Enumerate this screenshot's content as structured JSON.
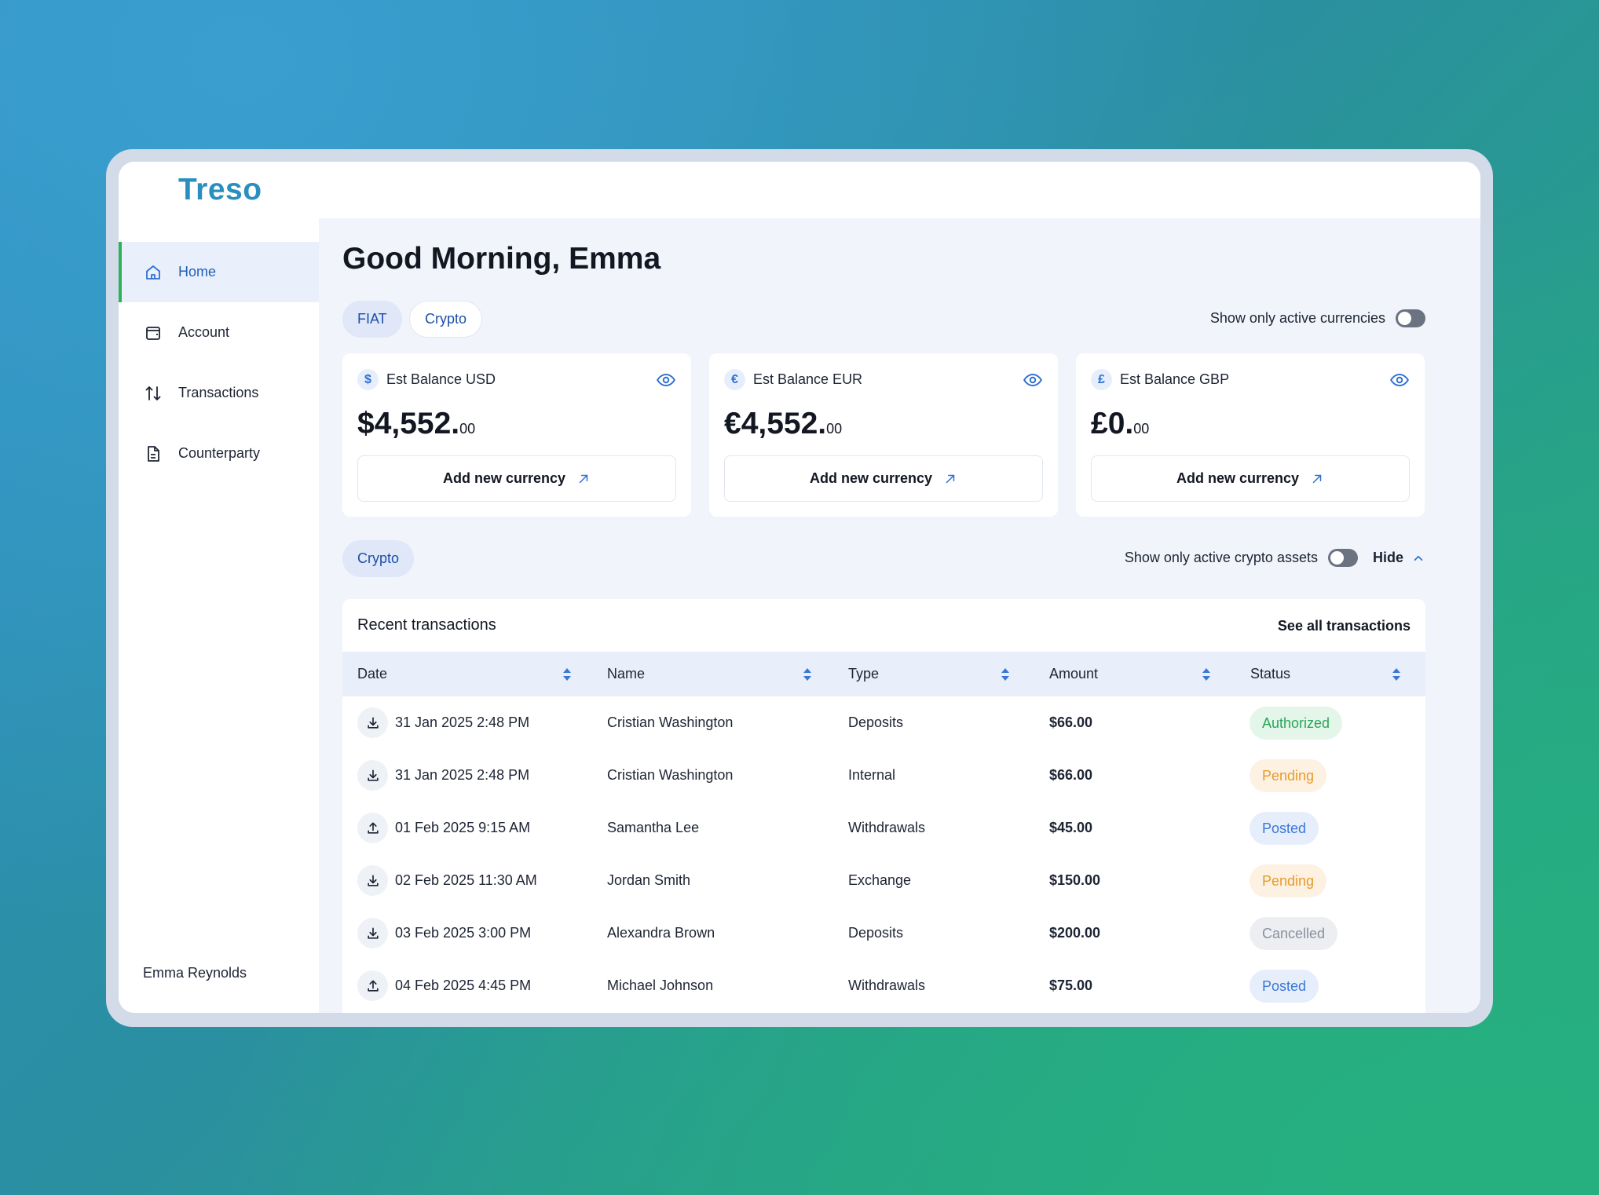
{
  "app": {
    "logo": "Treso"
  },
  "sidebar": {
    "items": [
      {
        "label": "Home",
        "icon": "home-icon",
        "active": true
      },
      {
        "label": "Account",
        "icon": "wallet-icon",
        "active": false
      },
      {
        "label": "Transactions",
        "icon": "arrows-up-down-icon",
        "active": false
      },
      {
        "label": "Counterparty",
        "icon": "document-icon",
        "active": false
      }
    ],
    "user_name": "Emma Reynolds"
  },
  "greeting": "Good Morning, Emma",
  "currency_tabs": {
    "fiat": "FIAT",
    "crypto": "Crypto"
  },
  "active_currencies_toggle": {
    "label": "Show only active currencies",
    "on": false
  },
  "balances": [
    {
      "symbol": "$",
      "label": "Est Balance USD",
      "amount": "$4,552.",
      "decimals": "00",
      "button": "Add new currency"
    },
    {
      "symbol": "€",
      "label": "Est Balance EUR",
      "amount": "€4,552.",
      "decimals": "00",
      "button": "Add new currency"
    },
    {
      "symbol": "£",
      "label": "Est Balance GBP",
      "amount": "£0.",
      "decimals": "00",
      "button": "Add new currency"
    }
  ],
  "crypto_section": {
    "chip": "Crypto",
    "toggle_label": "Show only active crypto assets",
    "toggle_on": false,
    "hide_label": "Hide"
  },
  "transactions": {
    "title": "Recent transactions",
    "see_all": "See all transactions",
    "columns": [
      "Date",
      "Name",
      "Type",
      "Amount",
      "Status"
    ],
    "rows": [
      {
        "direction": "in",
        "date": "31 Jan 2025 2:48 PM",
        "name": "Cristian Washington",
        "type": "Deposits",
        "amount": "$66.00",
        "status": "Authorized"
      },
      {
        "direction": "in",
        "date": "31 Jan 2025 2:48 PM",
        "name": "Cristian Washington",
        "type": "Internal",
        "amount": "$66.00",
        "status": "Pending"
      },
      {
        "direction": "out",
        "date": "01 Feb 2025 9:15 AM",
        "name": "Samantha Lee",
        "type": "Withdrawals",
        "amount": "$45.00",
        "status": "Posted"
      },
      {
        "direction": "in",
        "date": "02 Feb 2025 11:30 AM",
        "name": "Jordan Smith",
        "type": "Exchange",
        "amount": "$150.00",
        "status": "Pending"
      },
      {
        "direction": "in",
        "date": "03 Feb 2025 3:00 PM",
        "name": "Alexandra Brown",
        "type": "Deposits",
        "amount": "$200.00",
        "status": "Cancelled"
      },
      {
        "direction": "out",
        "date": "04 Feb 2025 4:45 PM",
        "name": "Michael Johnson",
        "type": "Withdrawals",
        "amount": "$75.00",
        "status": "Posted"
      }
    ]
  },
  "status_colors": {
    "Authorized": {
      "bg": "#e4f6ea",
      "fg": "#2aa55a"
    },
    "Pending": {
      "bg": "#fdf1e2",
      "fg": "#e99a2c"
    },
    "Posted": {
      "bg": "#e6eefb",
      "fg": "#3b78d6"
    },
    "Cancelled": {
      "bg": "#eceef2",
      "fg": "#8a909c"
    }
  }
}
